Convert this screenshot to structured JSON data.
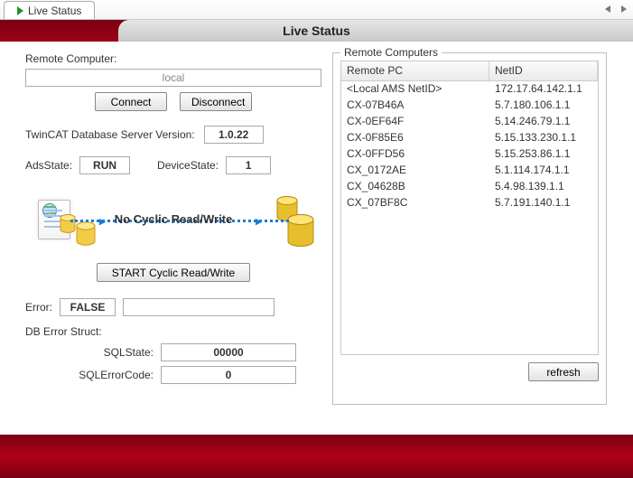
{
  "tab": {
    "title": "Live Status"
  },
  "page": {
    "title": "Live Status"
  },
  "remote": {
    "label": "Remote Computer:",
    "value": "local",
    "connect": "Connect",
    "disconnect": "Disconnect"
  },
  "version": {
    "label": "TwinCAT Database Server Version:",
    "value": "1.0.22"
  },
  "ads": {
    "label": "AdsState:",
    "value": "RUN"
  },
  "device": {
    "label": "DeviceState:",
    "value": "1"
  },
  "cyclic": {
    "caption": "No Cyclic Read/Write",
    "start": "START Cyclic Read/Write"
  },
  "error": {
    "label": "Error:",
    "value": "FALSE",
    "message": ""
  },
  "db_error": {
    "label": "DB Error Struct:",
    "sqlstate_label": "SQLState:",
    "sqlstate": "00000",
    "sqlcode_label": "SQLErrorCode:",
    "sqlcode": "0"
  },
  "computers": {
    "legend": "Remote Computers",
    "columns": {
      "pc": "Remote PC",
      "netid": "NetID"
    },
    "rows": [
      {
        "pc": "<Local AMS NetID>",
        "netid": "172.17.64.142.1.1"
      },
      {
        "pc": "CX-07B46A",
        "netid": "5.7.180.106.1.1"
      },
      {
        "pc": "CX-0EF64F",
        "netid": "5.14.246.79.1.1"
      },
      {
        "pc": "CX-0F85E6",
        "netid": "5.15.133.230.1.1"
      },
      {
        "pc": "CX-0FFD56",
        "netid": "5.15.253.86.1.1"
      },
      {
        "pc": "CX_0172AE",
        "netid": "5.1.114.174.1.1"
      },
      {
        "pc": "CX_04628B",
        "netid": "5.4.98.139.1.1"
      },
      {
        "pc": "CX_07BF8C",
        "netid": "5.7.191.140.1.1"
      }
    ],
    "refresh": "refresh"
  }
}
